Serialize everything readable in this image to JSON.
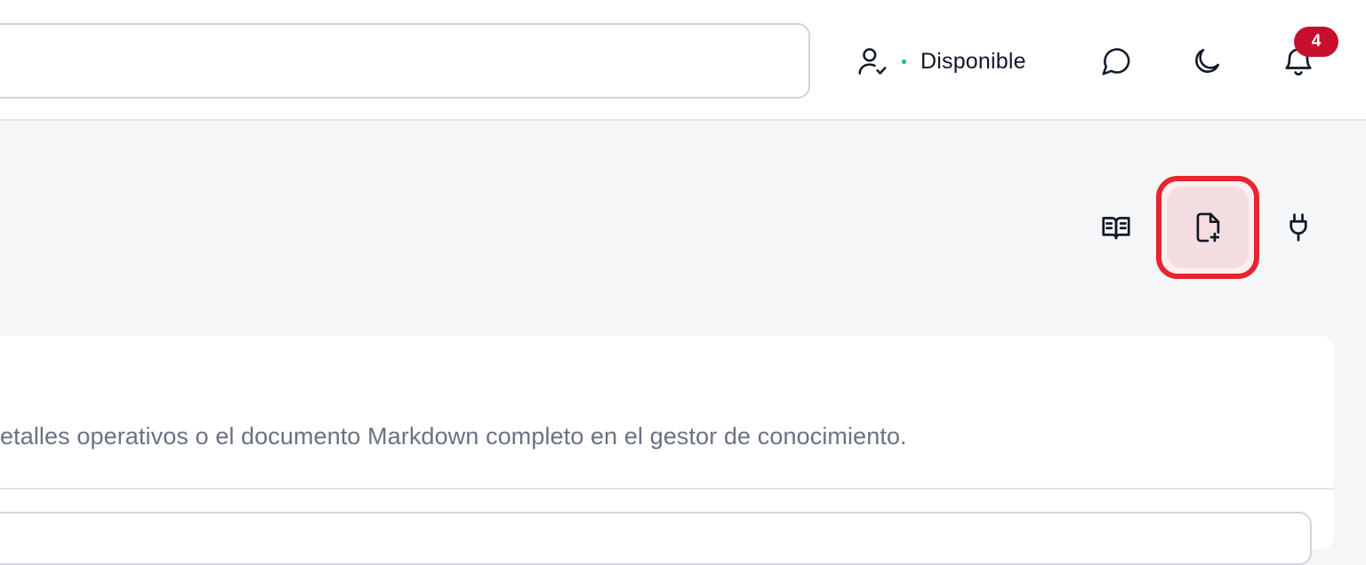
{
  "header": {
    "search": {
      "value": "",
      "placeholder": ""
    },
    "status": {
      "label": "Disponible",
      "icon": "user-check-icon",
      "dot_color": "#14b8a6"
    },
    "chat_icon": "message-circle-icon",
    "theme_icon": "moon-icon",
    "notifications": {
      "icon": "bell-icon",
      "count": "4",
      "badge_color": "#c8102e"
    }
  },
  "toolbar": {
    "items": [
      {
        "icon": "book-open-icon"
      },
      {
        "icon": "file-plus-icon",
        "highlight_color": "#e5262f"
      },
      {
        "icon": "plug-icon"
      }
    ]
  },
  "card": {
    "description": "etalles operativos o el documento Markdown completo en el gestor de conocimiento."
  }
}
